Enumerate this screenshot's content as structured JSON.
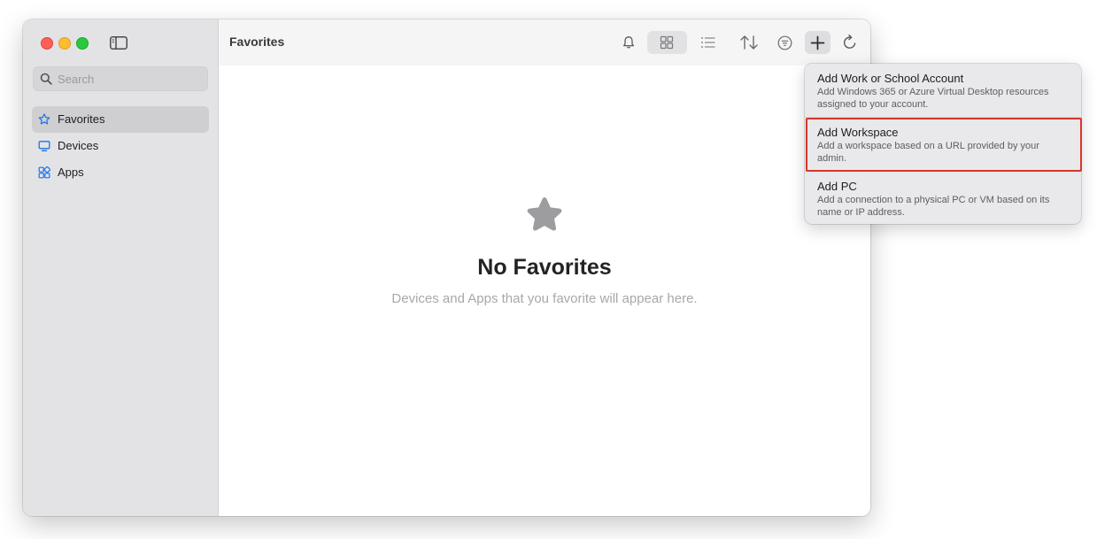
{
  "sidebar": {
    "search_placeholder": "Search",
    "items": [
      {
        "label": "Favorites",
        "icon": "star-icon",
        "active": true
      },
      {
        "label": "Devices",
        "icon": "monitor-icon",
        "active": false
      },
      {
        "label": "Apps",
        "icon": "apps-icon",
        "active": false
      }
    ]
  },
  "toolbar": {
    "title": "Favorites",
    "buttons": [
      "bell-icon",
      "grid-view-icon",
      "list-view-icon",
      "sort-icon",
      "filter-icon",
      "plus-icon",
      "refresh-icon"
    ]
  },
  "empty_state": {
    "title": "No Favorites",
    "subtitle": "Devices and Apps that you favorite will appear here."
  },
  "add_menu": {
    "items": [
      {
        "title": "Add Work or School Account",
        "description": "Add Windows 365 or Azure Virtual Desktop resources assigned to your account."
      },
      {
        "title": "Add Workspace",
        "description": "Add a workspace based on a URL provided by your admin.",
        "highlighted": true
      },
      {
        "title": "Add PC",
        "description": "Add a connection to a physical PC or VM based on its name or IP address."
      }
    ]
  },
  "colors": {
    "accent": "#1a73e8",
    "highlight_border": "#d9352a",
    "sidebar_bg": "#e3e3e5"
  }
}
